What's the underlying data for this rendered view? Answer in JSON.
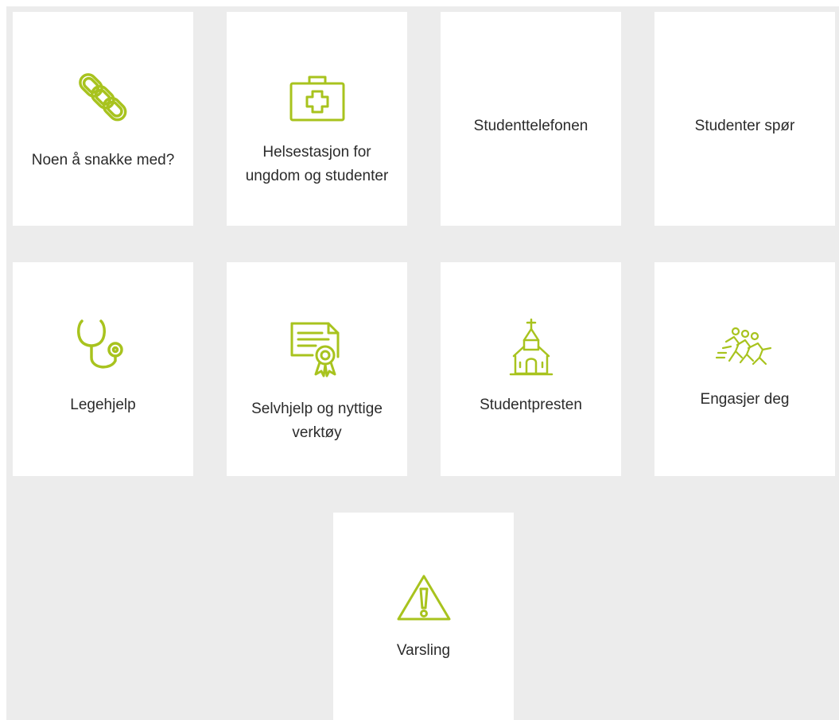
{
  "accent_color": "#a8c31e",
  "tiles": [
    {
      "label": "Noen å snakke med?",
      "icon": "chain-link-icon"
    },
    {
      "label": "Helsestasjon for ungdom og studenter",
      "icon": "first-aid-kit-icon"
    },
    {
      "label": "Studenttelefonen",
      "icon": null
    },
    {
      "label": "Studenter spør",
      "icon": null
    },
    {
      "label": "Legehjelp",
      "icon": "stethoscope-icon"
    },
    {
      "label": "Selvhjelp og nyttige verktøy",
      "icon": "certificate-icon"
    },
    {
      "label": "Studentpresten",
      "icon": "church-icon"
    },
    {
      "label": "Engasjer deg",
      "icon": "running-people-icon"
    },
    {
      "label": "Varsling",
      "icon": "warning-triangle-icon"
    }
  ]
}
